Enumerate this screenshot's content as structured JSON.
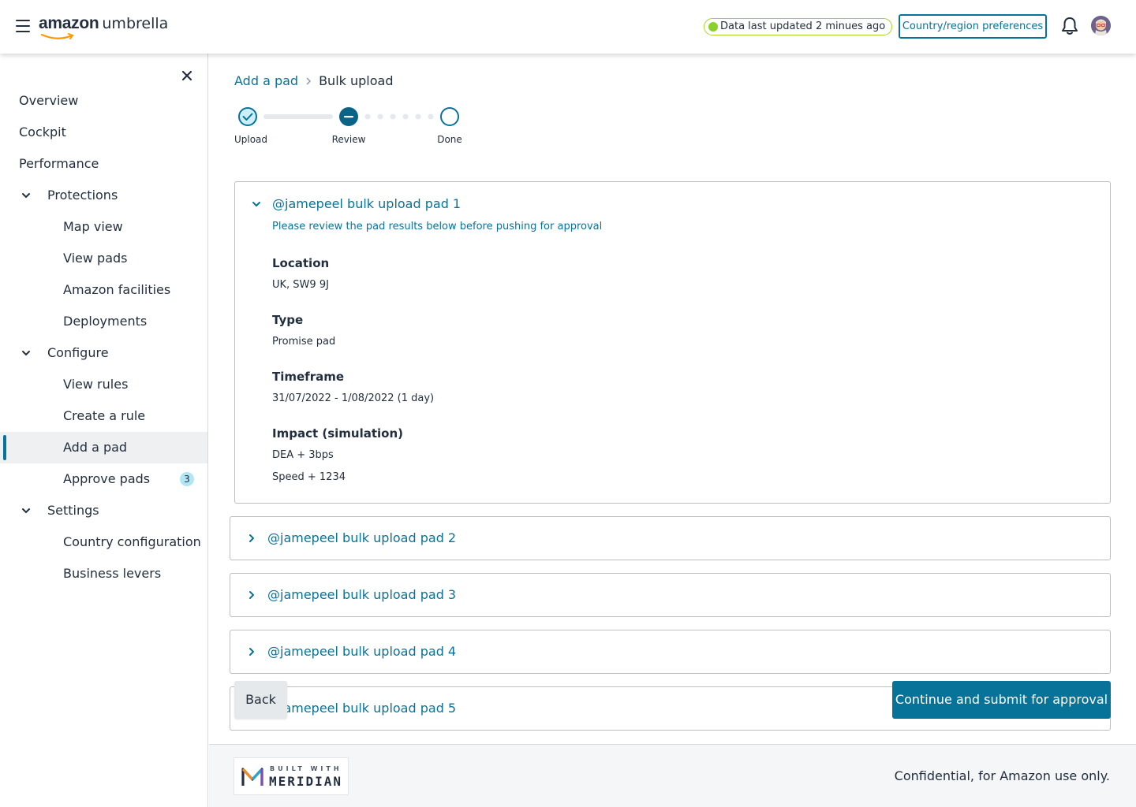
{
  "header": {
    "brand": "amazon",
    "app_name": "umbrella",
    "status": "Data last updated 2 minues ago",
    "preferences_button": "Country/region preferences"
  },
  "sidebar": {
    "items": [
      {
        "label": "Overview",
        "level": 0
      },
      {
        "label": "Cockpit",
        "level": 0
      },
      {
        "label": "Performance",
        "level": 0
      },
      {
        "label": "Protections",
        "level": 1,
        "expanded": true
      },
      {
        "label": "Map view",
        "level": 2
      },
      {
        "label": "View pads",
        "level": 2
      },
      {
        "label": "Amazon facilities",
        "level": 2
      },
      {
        "label": "Deployments",
        "level": 2
      },
      {
        "label": "Configure",
        "level": 1,
        "expanded": true
      },
      {
        "label": "View rules",
        "level": 2
      },
      {
        "label": "Create a rule",
        "level": 2
      },
      {
        "label": "Add a pad",
        "level": 2,
        "active": true
      },
      {
        "label": "Approve pads",
        "level": 2,
        "badge": "3"
      },
      {
        "label": "Settings",
        "level": 1,
        "expanded": true
      },
      {
        "label": "Country configuration",
        "level": 2
      },
      {
        "label": "Business levers",
        "level": 2
      }
    ]
  },
  "breadcrumb": {
    "parent": "Add a pad",
    "current": "Bulk upload"
  },
  "stepper": {
    "steps": [
      {
        "label": "Upload",
        "state": "complete"
      },
      {
        "label": "Review",
        "state": "current"
      },
      {
        "label": "Done",
        "state": "upcoming"
      }
    ]
  },
  "pads": [
    {
      "title": "@jamepeel bulk upload pad 1",
      "expanded": true,
      "subtitle": "Please review the pad results below before pushing for approval",
      "location_label": "Location",
      "location": "UK, SW9 9J",
      "type_label": "Type",
      "type": "Promise pad",
      "timeframe_label": "Timeframe",
      "timeframe": "31/07/2022 - 1/08/2022 (1 day)",
      "impact_label": "Impact (simulation)",
      "impact_dea": "DEA + 3bps",
      "impact_speed": "Speed + 1234"
    },
    {
      "title": "@jamepeel bulk upload pad 2",
      "expanded": false
    },
    {
      "title": "@jamepeel bulk upload pad 3",
      "expanded": false
    },
    {
      "title": "@jamepeel bulk upload pad 4",
      "expanded": false
    },
    {
      "title": "@jamepeel bulk upload pad 5",
      "expanded": false
    }
  ],
  "actions": {
    "back": "Back",
    "submit": "Continue and submit for approval"
  },
  "footer": {
    "built_with": "BUILT WITH",
    "meridian": "MERIDIAN",
    "confidential": "Confidential, for Amazon use only."
  },
  "colors": {
    "accent": "#077398",
    "status_green": "#8bd12a",
    "text": "#232f3e"
  }
}
